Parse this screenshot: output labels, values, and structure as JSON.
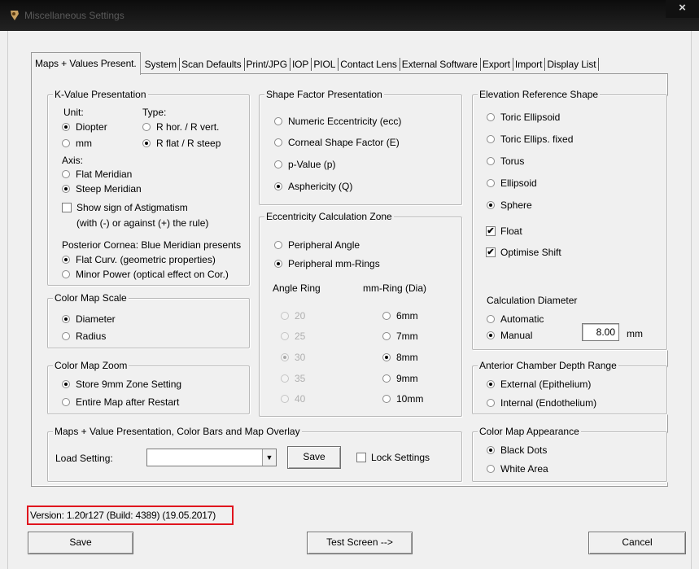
{
  "window": {
    "title": "Miscellaneous Settings",
    "close_glyph": "×"
  },
  "tabs": [
    "Maps + Values Present.",
    "System",
    "Scan Defaults",
    "Print/JPG",
    "IOP",
    "PIOL",
    "Contact Lens",
    "External Software",
    "Export",
    "Import",
    "Display List"
  ],
  "kvalue": {
    "legend": "K-Value Presentation",
    "unit_label": "Unit:",
    "type_label": "Type:",
    "unit_diopter": "Diopter",
    "unit_mm": "mm",
    "type_rhor": "R hor. / R vert.",
    "type_rflat": "R flat / R steep",
    "axis_label": "Axis:",
    "axis_flat": "Flat Meridian",
    "axis_steep": "Steep Meridian",
    "astig_line1": "Show sign of Astigmatism",
    "astig_line2": "(with (-) or against (+) the rule)",
    "posterior_label": "Posterior Cornea: Blue Meridian presents",
    "posterior_flat": "Flat Curv. (geometric properties)",
    "posterior_minor": "Minor Power (optical effect on Cor.)"
  },
  "colorscale": {
    "legend": "Color Map Scale",
    "diameter": "Diameter",
    "radius": "Radius"
  },
  "colorzoom": {
    "legend": "Color Map Zoom",
    "store": "Store 9mm Zone Setting",
    "entire": "Entire Map after Restart"
  },
  "shapefactor": {
    "legend": "Shape Factor Presentation",
    "numeric": "Numeric Eccentricity (ecc)",
    "corneal": "Corneal Shape Factor (E)",
    "pvalue": "p-Value (p)",
    "asphericity": "Asphericity (Q)"
  },
  "eccentricity": {
    "legend": "Eccentricity Calculation Zone",
    "peripheral_angle": "Peripheral Angle",
    "peripheral_rings": "Peripheral mm-Rings",
    "angle_ring_label": "Angle Ring",
    "mm_ring_label": "mm-Ring (Dia)",
    "angles": [
      "20",
      "25",
      "30",
      "35",
      "40"
    ],
    "mm_rings": [
      "6mm",
      "7mm",
      "8mm",
      "9mm",
      "10mm"
    ]
  },
  "elevation": {
    "legend": "Elevation Reference Shape",
    "toric_ellipsoid": "Toric Ellipsoid",
    "toric_fixed": "Toric Ellips. fixed",
    "torus": "Torus",
    "ellipsoid": "Ellipsoid",
    "sphere": "Sphere",
    "float": "Float",
    "optimise": "Optimise Shift",
    "calc_label": "Calculation Diameter",
    "automatic": "Automatic",
    "manual": "Manual",
    "manual_value": "8.00",
    "manual_unit": "mm",
    "check_glyph": "✔"
  },
  "acd": {
    "legend": "Anterior Chamber Depth Range",
    "external": "External (Epithelium)",
    "internal": "Internal (Endothelium)"
  },
  "appearance": {
    "legend": "Color Map Appearance",
    "black": "Black Dots",
    "white": "White Area"
  },
  "overlay": {
    "legend": "Maps + Value Presentation, Color Bars and Map Overlay",
    "load_label": "Load Setting:",
    "load_value": "",
    "arrow_glyph": "▼",
    "save": "Save",
    "lock": "Lock Settings"
  },
  "version": "Version: 1.20r127  (Build: 4389) (19.05.2017)",
  "footer": {
    "save": "Save",
    "test": "Test Screen -->",
    "cancel": "Cancel"
  }
}
